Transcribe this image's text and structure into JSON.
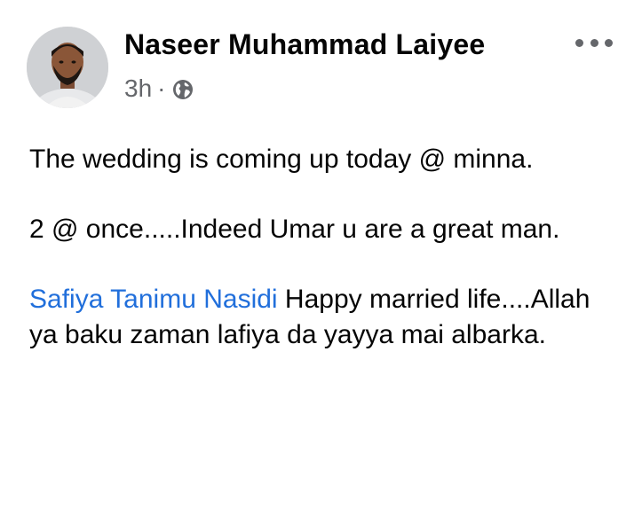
{
  "post": {
    "author": "Naseer Muhammad Laiyee",
    "time": "3h",
    "separator": "·",
    "privacy_icon": "globe-icon",
    "more_icon": "more-options-icon",
    "paragraphs": [
      {
        "text": "The wedding is coming up today @ minna."
      },
      {
        "text": "2 @ once.....Indeed Umar u are a great man."
      },
      {
        "mention": "Safiya Tanimu Nasidi",
        "text": " Happy married life....Allah ya baku zaman lafiya da yayya mai albarka."
      }
    ],
    "colors": {
      "name": "#050505",
      "meta": "#65676b",
      "mention": "#216fdb",
      "background": "#ffffff"
    }
  }
}
